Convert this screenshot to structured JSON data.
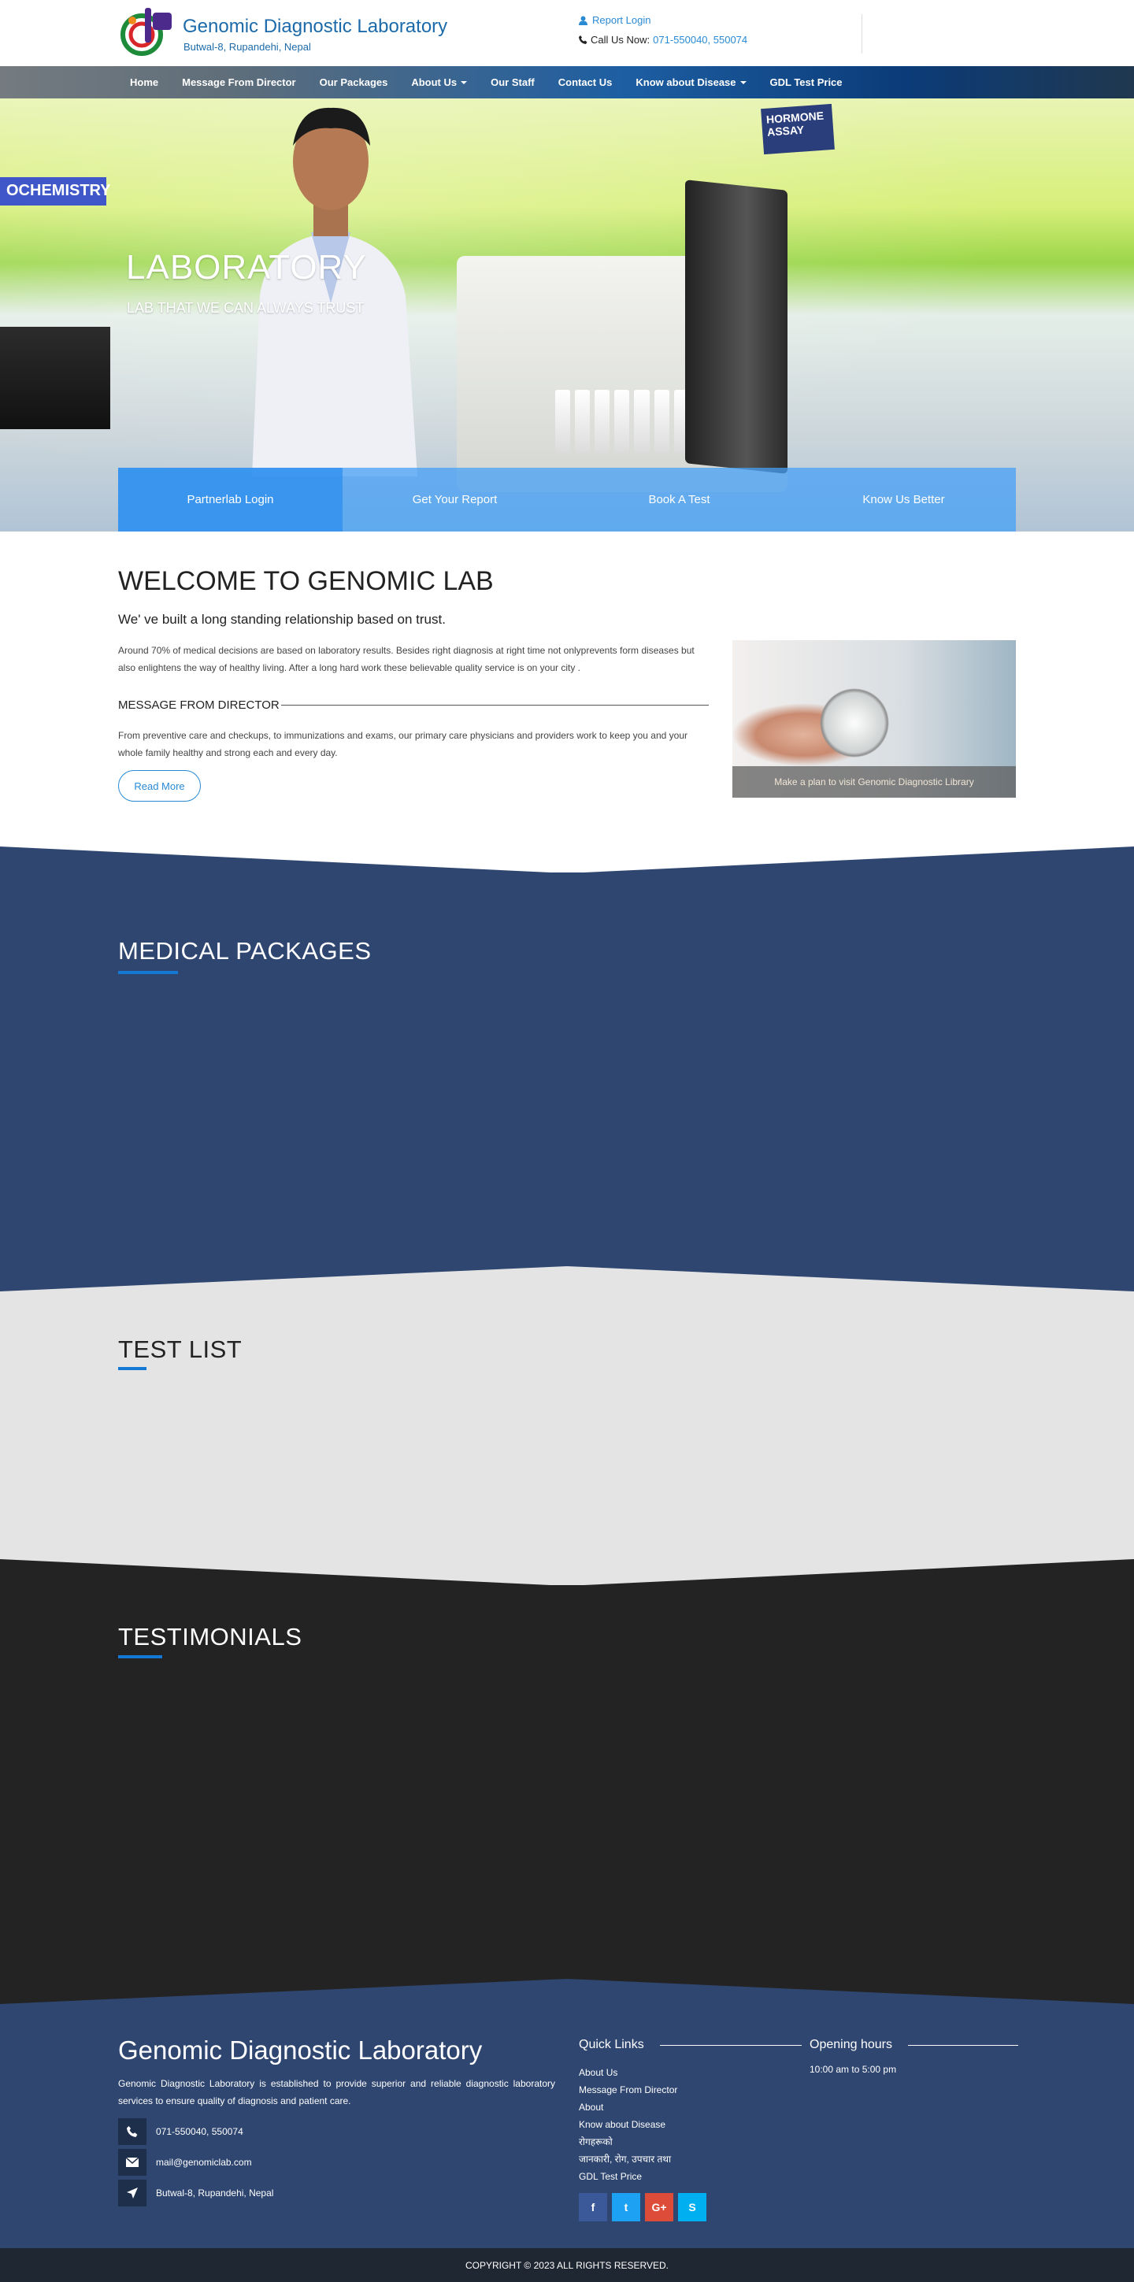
{
  "header": {
    "title": "Genomic Diagnostic Laboratory",
    "subtitle": "Butwal-8, Rupandehi, Nepal",
    "report_login": "Report Login",
    "call_label": "Call Us Now:",
    "call_numbers": "071-550040, 550074"
  },
  "nav": {
    "items": [
      "Home",
      "Message From Director",
      "Our Packages",
      "About Us",
      "Our Staff",
      "Contact Us",
      "Know about Disease",
      "GDL Test Price"
    ]
  },
  "hero": {
    "title": "LABORATORY",
    "subtitle": "LAB THAT WE CAN ALWAYS TRUST",
    "board_left": "OCHEMISTRY",
    "board_right": "HORMONE ASSAY",
    "tiles": [
      "Partnerlab Login",
      "Get Your Report",
      "Book A Test",
      "Know Us Better"
    ]
  },
  "welcome": {
    "heading": "WELCOME TO GENOMIC LAB",
    "lead": "We' ve built a long standing relationship based on trust.",
    "paragraph": "Around 70% of medical decisions are based on laboratory results. Besides right diagnosis at right time not onlyprevents form diseases but also enlightens the way of healthy living. After a long hard work these believable quality service is on your city .",
    "director_heading": "MESSAGE FROM DIRECTOR",
    "director_text": "From preventive care and checkups, to immunizations and exams, our primary care physicians and providers work to keep you and your whole family healthy and strong each and every day.",
    "read_more": "Read More",
    "card_caption": "Make a plan to visit Genomic Diagnostic Library"
  },
  "sections": {
    "medical": "MEDICAL PACKAGES",
    "testlist": "TEST LIST",
    "testimonials": "TESTIMONIALS"
  },
  "footer": {
    "title": "Genomic Diagnostic Laboratory",
    "description": "Genomic Diagnostic Laboratory is established to provide superior and reliable diagnostic laboratory services to ensure quality of diagnosis and patient care.",
    "phone": "071-550040, 550074",
    "email": "mail@genomiclab.com",
    "address": "Butwal-8, Rupandehi, Nepal",
    "quick_links_title": "Quick Links",
    "links": [
      "About Us",
      "Message From Director",
      "About",
      "Know about Disease",
      "रोगहरूको",
      "जानकारी, रोग, उपचार तथा",
      "GDL Test Price"
    ],
    "hours_title": "Opening hours",
    "hours": "10:00 am to 5:00 pm",
    "social": [
      "f",
      "t",
      "G+",
      "S"
    ]
  },
  "copyright": "COPYRIGHT © 2023 ALL RIGHTS RESERVED.",
  "colors": {
    "brand_blue": "#1c6aa9",
    "link_blue": "#2a8ad4",
    "medical_bg": "#2f4670",
    "testlist_bg": "#e4e4e4",
    "testimonials_bg": "#232323",
    "accent_underline": "#1479d4"
  }
}
